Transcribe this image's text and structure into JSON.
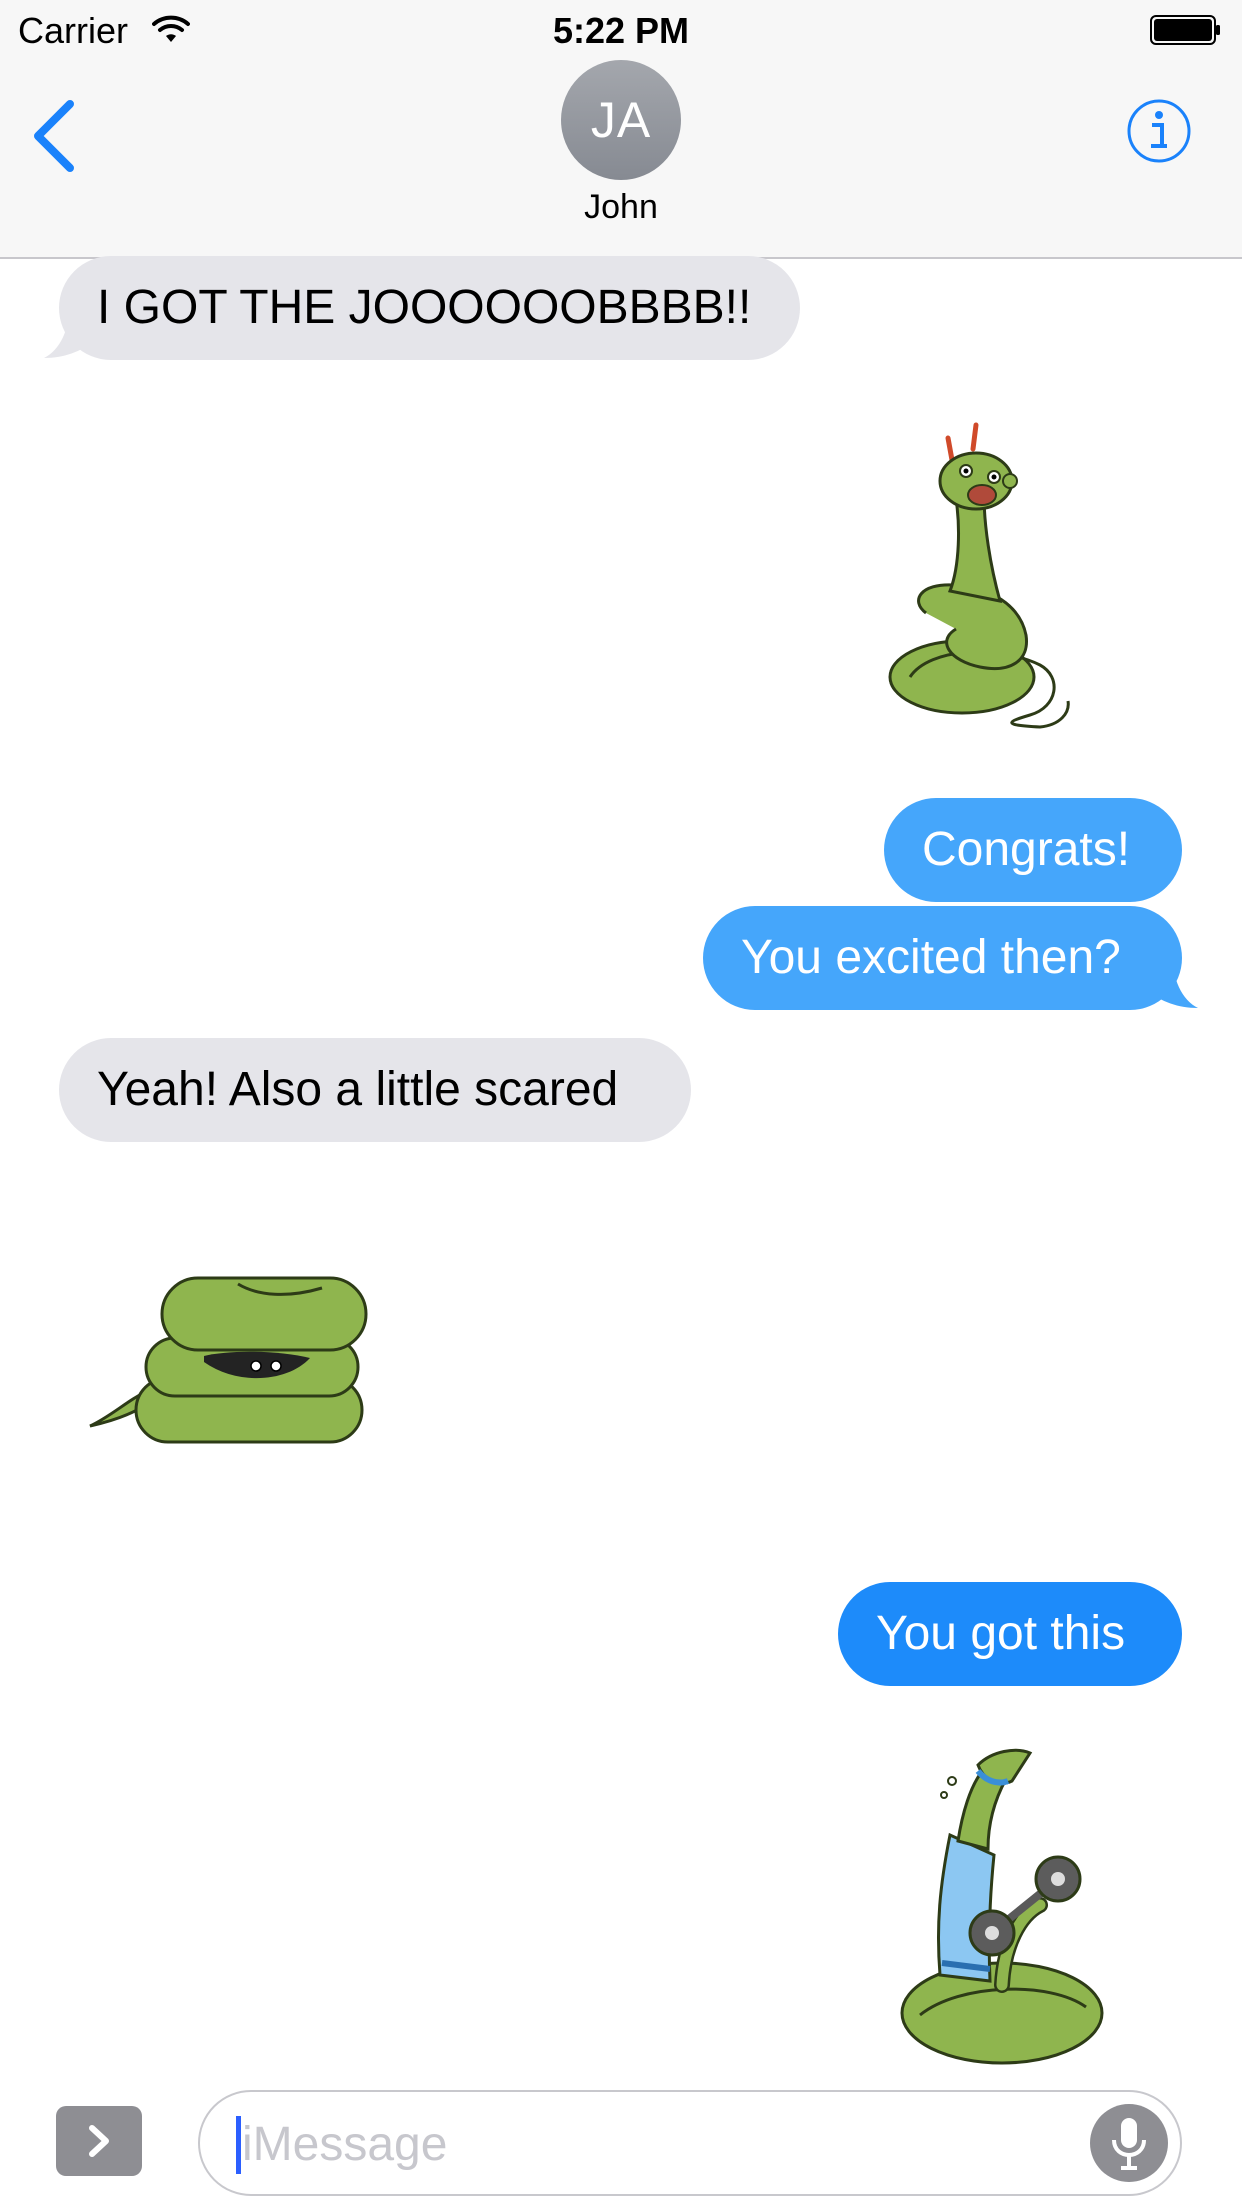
{
  "status_bar": {
    "carrier": "Carrier",
    "time": "5:22 PM"
  },
  "header": {
    "avatar_initials": "JA",
    "contact_name": "John",
    "back_icon": "chevron-left-icon",
    "info_icon": "info-icon"
  },
  "messages": [
    {
      "side": "received",
      "kind": "text",
      "text": "I GOT THE JOOOOOOBBBB!!"
    },
    {
      "side": "sent",
      "kind": "sticker",
      "sticker": "excited-snake-sticker"
    },
    {
      "side": "sent",
      "kind": "text",
      "text": "Congrats!"
    },
    {
      "side": "sent",
      "kind": "text",
      "text": "You excited then?"
    },
    {
      "side": "received",
      "kind": "text",
      "text": "Yeah! Also a little scared"
    },
    {
      "side": "received",
      "kind": "sticker",
      "sticker": "hiding-snake-sticker"
    },
    {
      "side": "sent",
      "kind": "text",
      "text": "You got this"
    },
    {
      "side": "sent",
      "kind": "sticker",
      "sticker": "workout-snake-sticker"
    }
  ],
  "composer": {
    "placeholder": "iMessage",
    "apps_icon": "chevron-right-icon",
    "mic_icon": "microphone-icon"
  },
  "colors": {
    "sent_bubble": "#1d8bfa",
    "sent_bubble_light": "#45a6fb",
    "received_bubble": "#e5e5ea",
    "accent": "#1a82fb",
    "snake_green": "#8fb54e"
  }
}
